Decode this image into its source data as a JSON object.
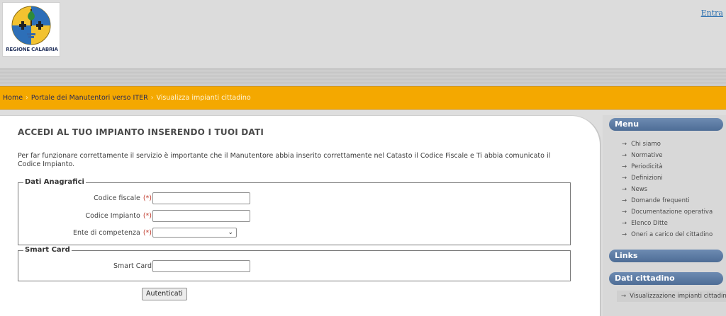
{
  "header": {
    "logo_text": "REGIONE CALABRIA",
    "login_link": "Entra"
  },
  "breadcrumb": {
    "items": [
      "Home",
      "Portale dei Manutentori verso ITER"
    ],
    "separator": "›",
    "current": "Visualizza impianti cittadino"
  },
  "main": {
    "title": "ACCEDI AL TUO IMPIANTO INSERENDO I TUOI DATI",
    "info": "Per far funzionare correttamente il servizio è importante che il Manutentore abbia inserito correttamente nel Catasto il Codice Fiscale e Ti abbia comunicato il Codice Impianto.",
    "anagrafici": {
      "legend": "Dati Anagrafici",
      "codice_fiscale_label": "Codice fiscale",
      "codice_impianto_label": "Codice Impianto",
      "ente_label": "Ente di competenza",
      "required_mark": "(*)",
      "codice_fiscale_value": "",
      "codice_impianto_value": "",
      "ente_value": ""
    },
    "smartcard": {
      "legend": "Smart Card",
      "label": "Smart Card",
      "value": ""
    },
    "submit_label": "Autenticati"
  },
  "sidebar": {
    "menu_title": "Menu",
    "arrow": "→",
    "menu_items": [
      "Chi siamo",
      "Normative",
      "Periodicità",
      "Definizioni",
      "News",
      "Domande frequenti",
      "Documentazione operativa",
      "Elenco Ditte",
      "Oneri a carico del cittadino"
    ],
    "links_title": "Links",
    "dati_title": "Dati cittadino",
    "dati_item": "Visualizzazione impianti cittadino"
  },
  "colors": {
    "breadcrumb_bar": "#f4a800",
    "section_header": "#5a7aa3",
    "required": "#c0392b",
    "link": "#2a6fb0"
  }
}
